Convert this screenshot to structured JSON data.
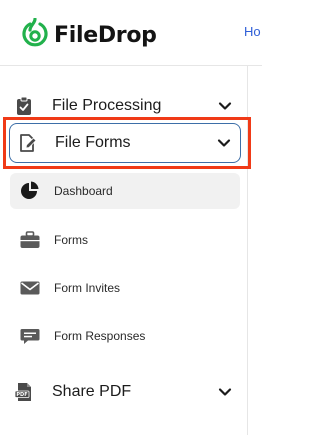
{
  "header": {
    "app_name": "FileDrop",
    "top_link": "Ho"
  },
  "sidebar": {
    "sections": [
      {
        "label": "File Processing",
        "icon": "clipboard-check-icon",
        "expanded": false
      },
      {
        "label": "File Forms",
        "icon": "document-edit-icon",
        "expanded": true,
        "focused": true
      },
      {
        "label": "Share PDF",
        "icon": "pdf-icon",
        "expanded": false
      }
    ],
    "subitems": [
      {
        "label": "Dashboard",
        "icon": "pie-chart-icon",
        "active": true
      },
      {
        "label": "Forms",
        "icon": "briefcase-icon"
      },
      {
        "label": "Form Invites",
        "icon": "envelope-icon"
      },
      {
        "label": "Form Responses",
        "icon": "chat-bubble-icon"
      }
    ]
  },
  "colors": {
    "brand_green": "#22b14c",
    "link_blue": "#2f5fd7",
    "focus_border": "#3d6fa8",
    "highlight_red": "#f03a17",
    "icon_gray": "#4a4a4a",
    "active_bg": "#f1f1f1"
  }
}
